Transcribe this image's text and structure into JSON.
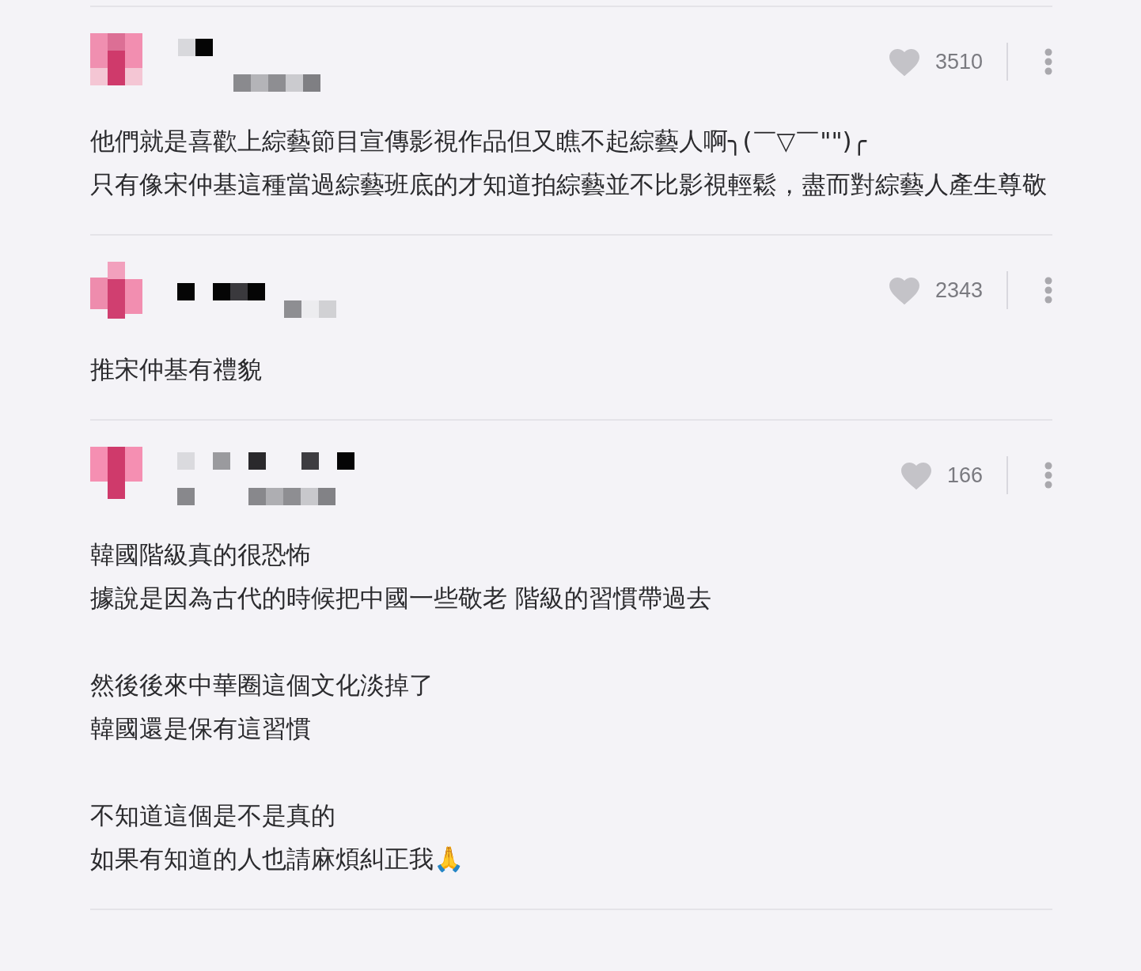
{
  "comments": [
    {
      "likes": "3510",
      "liked": false,
      "paragraphs": [
        [
          "他們就是喜歡上綜藝節目宣傳影視作品但又瞧不起綜藝人啊╮(￣▽￣\"\")╭",
          "只有像宋仲基這種當過綜藝班底的才知道拍綜藝並不比影視輕鬆，盡而對綜藝人產生尊敬"
        ]
      ]
    },
    {
      "likes": "2343",
      "liked": false,
      "paragraphs": [
        [
          "推宋仲基有禮貌"
        ]
      ]
    },
    {
      "likes": "166",
      "liked": false,
      "paragraphs": [
        [
          "韓國階級真的很恐怖",
          "據說是因為古代的時候把中國一些敬老 階級的習慣帶過去"
        ],
        [
          "然後後來中華圈這個文化淡掉了",
          "韓國還是保有這習慣"
        ],
        [
          "不知道這個是不是真的",
          "如果有知道的人也請麻煩糾正我🙏"
        ]
      ]
    }
  ]
}
